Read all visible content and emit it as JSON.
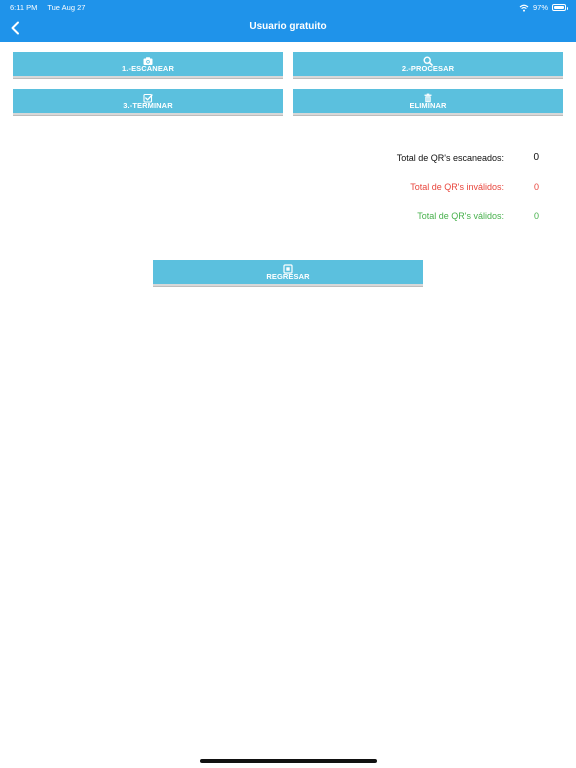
{
  "status_bar": {
    "time": "6:11 PM",
    "date": "Tue Aug 27",
    "battery": "97%",
    "battery_level": 0.97
  },
  "header": {
    "title": "Usuario gratuito"
  },
  "buttons": {
    "scan": {
      "label": "1.-ESCANEAR",
      "icon": "camera-icon"
    },
    "process": {
      "label": "2.-PROCESAR",
      "icon": "search-icon"
    },
    "finish": {
      "label": "3.-TERMINAR",
      "icon": "checkbox-icon"
    },
    "delete": {
      "label": "ELIMINAR",
      "icon": "trash-icon"
    },
    "back": {
      "label": "REGRESAR",
      "icon": "home-square-icon"
    }
  },
  "stats": {
    "scanned": {
      "label": "Total de QR's escaneados:",
      "value": "0"
    },
    "invalid": {
      "label": "Total de QR's inválidos:",
      "value": "0"
    },
    "valid": {
      "label": "Total de QR's válidos:",
      "value": "0"
    }
  },
  "colors": {
    "header": "#1f93ea",
    "button": "#5bc0de",
    "invalid": "#e8453c",
    "valid": "#46b04b"
  }
}
